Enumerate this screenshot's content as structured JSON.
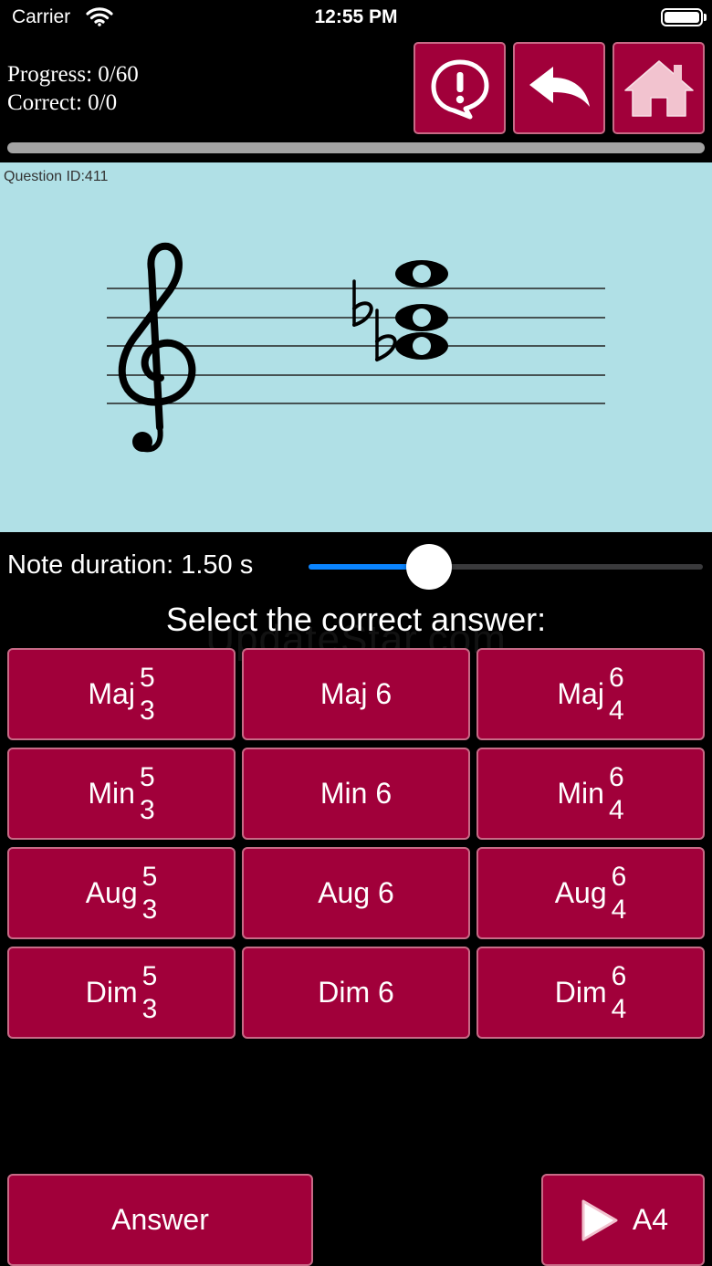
{
  "status_bar": {
    "carrier": "Carrier",
    "time": "12:55 PM"
  },
  "header": {
    "progress_text": "Progress: 0/60",
    "correct_text": "Correct: 0/0",
    "progress_fraction": 0
  },
  "icons": {
    "alert": "alert-bubble-icon",
    "back": "back-arrow-icon",
    "home": "home-icon"
  },
  "staff": {
    "question_id": "Question ID:411"
  },
  "duration": {
    "label": "Note duration: 1.50  s",
    "value": 1.5,
    "fraction": 0.305
  },
  "prompt": "Select the correct answer:",
  "watermark": "UpdateStar.com",
  "answers": [
    {
      "label": "Maj",
      "top": "5",
      "bottom": "3"
    },
    {
      "label": "Maj 6"
    },
    {
      "label": "Maj",
      "top": "6",
      "bottom": "4"
    },
    {
      "label": "Min",
      "top": "5",
      "bottom": "3"
    },
    {
      "label": "Min 6"
    },
    {
      "label": "Min",
      "top": "6",
      "bottom": "4"
    },
    {
      "label": "Aug",
      "top": "5",
      "bottom": "3"
    },
    {
      "label": "Aug 6"
    },
    {
      "label": "Aug",
      "top": "6",
      "bottom": "4"
    },
    {
      "label": "Dim",
      "top": "5",
      "bottom": "3"
    },
    {
      "label": "Dim 6"
    },
    {
      "label": "Dim",
      "top": "6",
      "bottom": "4"
    }
  ],
  "footer": {
    "answer_label": "Answer",
    "play_label": "A4"
  },
  "colors": {
    "button": "#a1003a",
    "staff_bg": "#b0e0e6",
    "accent": "#0a84ff"
  }
}
